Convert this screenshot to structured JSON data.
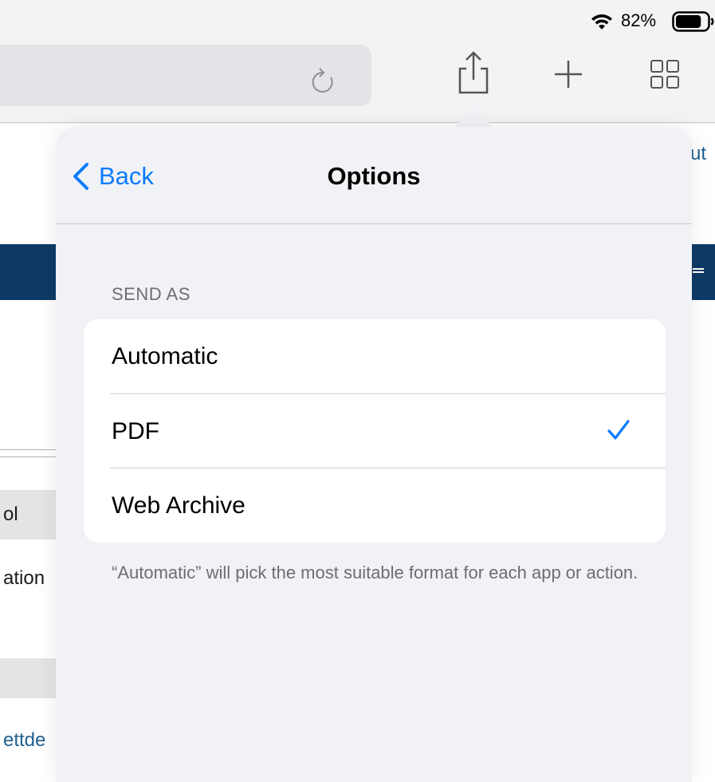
{
  "status_bar": {
    "battery_percent": "82%",
    "wifi_icon": "wifi-icon",
    "battery_icon": "battery-icon",
    "battery_level": 0.82
  },
  "toolbar": {
    "reload_icon": "reload-icon",
    "share_icon": "share-icon",
    "new_tab_icon": "plus-icon",
    "tabs_icon": "tabs-grid-icon"
  },
  "background_page": {
    "fragments": [
      "ol",
      "ation",
      "ettde"
    ],
    "right_fragment": "ut"
  },
  "popover": {
    "back_label": "Back",
    "title": "Options",
    "section_header": "SEND AS",
    "options": [
      {
        "label": "Automatic",
        "selected": false
      },
      {
        "label": "PDF",
        "selected": true
      },
      {
        "label": "Web Archive",
        "selected": false
      }
    ],
    "footer_note": "“Automatic” will pick the most suitable format for each app or action."
  },
  "colors": {
    "accent": "#0a7bff",
    "page_header_blue": "#0f3a66",
    "secondary_text": "#6d6d72"
  }
}
